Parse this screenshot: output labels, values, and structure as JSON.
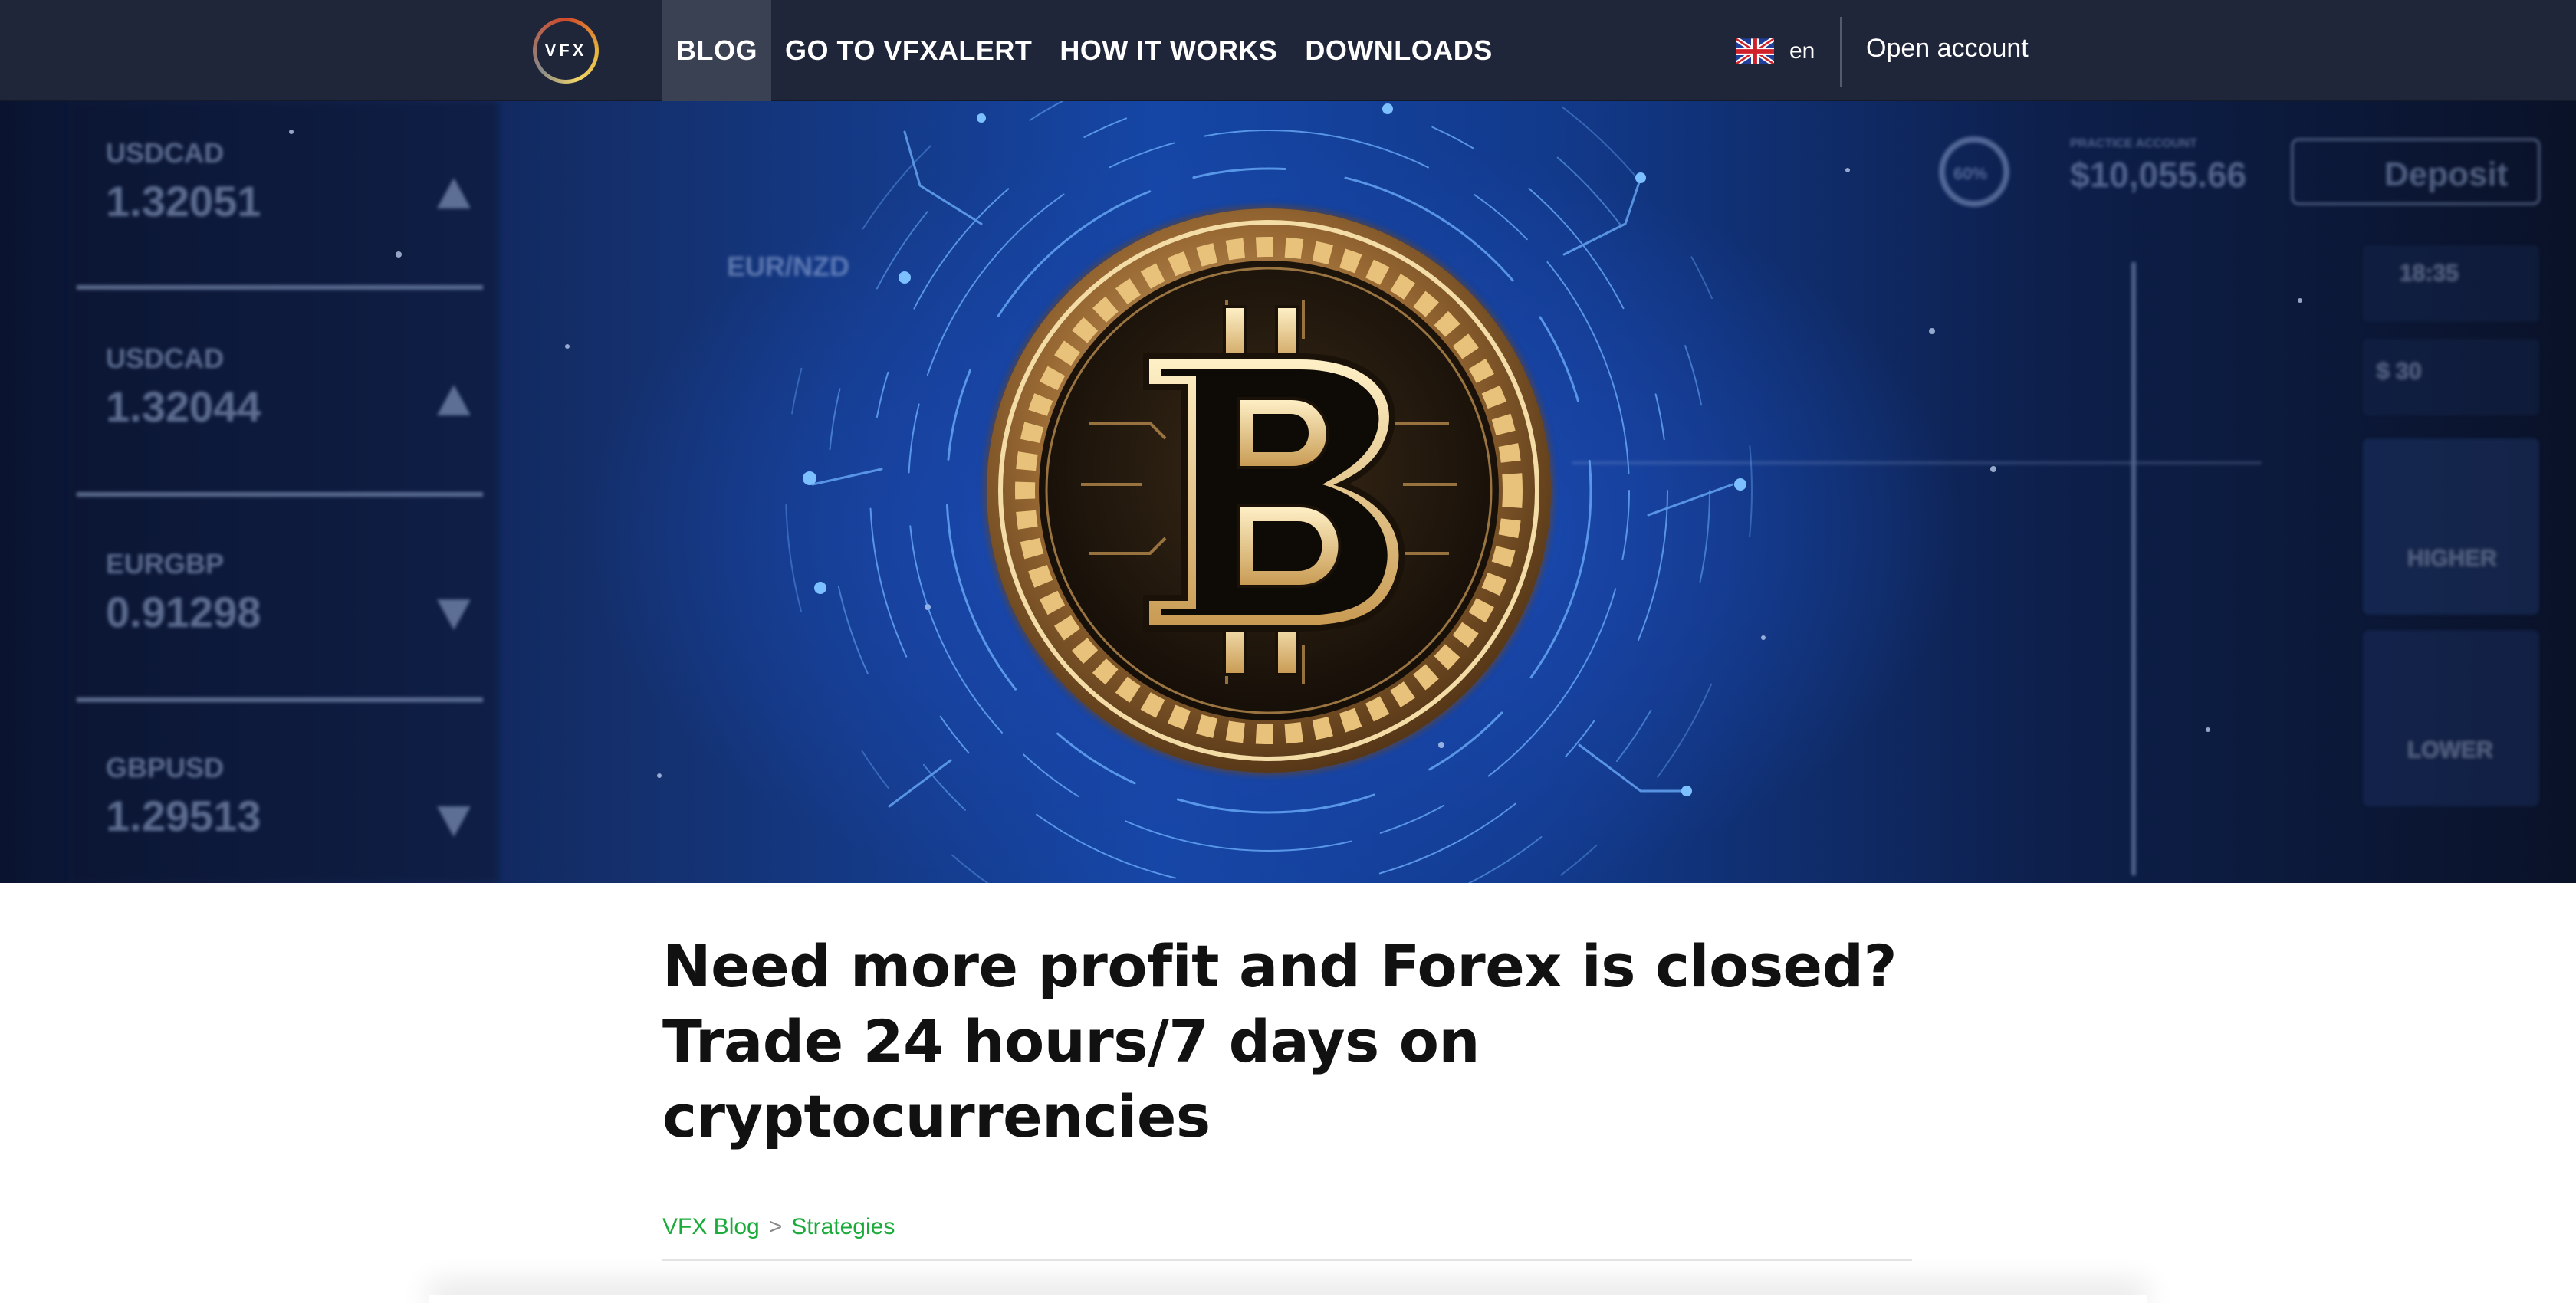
{
  "header": {
    "logo_text": "VFX",
    "nav": [
      {
        "label": "BLOG",
        "active": true
      },
      {
        "label": "GO TO VFXALERT",
        "active": false
      },
      {
        "label": "HOW IT WORKS",
        "active": false
      },
      {
        "label": "DOWNLOADS",
        "active": false
      }
    ],
    "language": {
      "code": "en",
      "icon": "uk-flag-icon"
    },
    "open_account_label": "Open account"
  },
  "hero": {
    "image": "bitcoin-coin-illustration",
    "background_panels": [
      {
        "pair": "USDCAD",
        "price": "1.32051"
      },
      {
        "pair": "USDCAD",
        "price": "1.32044"
      },
      {
        "pair": "EURGBP",
        "price": "0.91298"
      },
      {
        "pair": "GBPUSD",
        "price": "1.29513"
      }
    ],
    "chart_pair": "EUR/NZD",
    "account_label": "PRACTICE ACCOUNT",
    "balance": "$10,055.66",
    "deposit_label": "Deposit",
    "percent": "60%",
    "time": "18:35",
    "amount": "$ 30",
    "higher_label": "HIGHER",
    "lower_label": "LOWER"
  },
  "article": {
    "title_lines": [
      "Need more profit and Forex is closed?",
      "Trade 24 hours/7 days on",
      "cryptocurrencies"
    ],
    "breadcrumb": {
      "root": "VFX Blog",
      "separator": ">",
      "current": "Strategies"
    }
  },
  "colors": {
    "nav_bg": "#20263a",
    "nav_active": "#3a4153",
    "breadcrumb_link": "#1aab3a",
    "title_text": "#111111"
  }
}
